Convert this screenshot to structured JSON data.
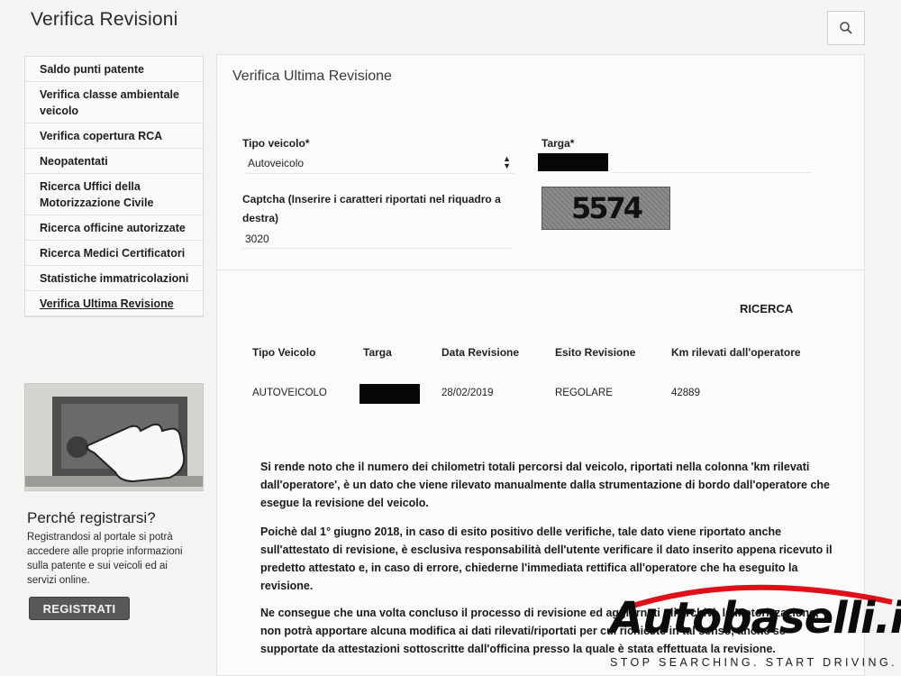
{
  "header": {
    "title": "Verifica Revisioni",
    "search_icon": "search-icon"
  },
  "sidebar": {
    "items": [
      {
        "label": "Saldo punti patente"
      },
      {
        "label": "Verifica classe ambientale veicolo"
      },
      {
        "label": "Verifica copertura RCA"
      },
      {
        "label": "Neopatentati"
      },
      {
        "label": "Ricerca Uffici della Motorizzazione Civile"
      },
      {
        "label": "Ricerca officine autorizzate"
      },
      {
        "label": "Ricerca Medici Certificatori"
      },
      {
        "label": "Statistiche immatricolazioni"
      },
      {
        "label": "Verifica Ultima Revisione",
        "active": true
      }
    ]
  },
  "promo": {
    "title": "Perché registrarsi?",
    "text": "Registrandosi al portale si potrà accedere alle proprie informazioni sulla patente e sui veicoli ed ai servizi online.",
    "button": "REGISTRATI"
  },
  "form": {
    "section_title": "Verifica Ultima Revisione",
    "tipo_veicolo_label": "Tipo veicolo*",
    "tipo_veicolo_value": "Autoveicolo",
    "targa_label": "Targa*",
    "captcha_label": "Captcha (Inserire i caratteri riportati nel riquadro a destra)",
    "captcha_value": "3020",
    "captcha_image_text": "5574"
  },
  "results": {
    "ricerca_label": "RICERCA",
    "columns": [
      "Tipo Veicolo",
      "Targa",
      "Data Revisione",
      "Esito Revisione",
      "Km rilevati dall'operatore"
    ],
    "row": {
      "tipo": "AUTOVEICOLO",
      "data": "28/02/2019",
      "esito": "REGOLARE",
      "km": "42889"
    }
  },
  "notes": [
    "Si rende noto che il numero dei chilometri totali percorsi dal veicolo, riportati nella colonna 'km rilevati dall'operatore', è un dato che viene rilevato manualmente dalla strumentazione di bordo dall'operatore che esegue la revisione del veicolo.",
    "Poichè dal 1° giugno 2018, in caso di esito positivo delle verifiche, tale dato viene riportato anche sull'attestato di revisione, è esclusiva responsabilità dell'utente verificare il dato inserito appena ricevuto il predetto attestato e, in caso di errore, chiederne l'immediata rettifica all'operatore che ha eseguito la revisione.",
    "Ne consegue che una volta concluso il processo di revisione ed aggiornati gli archivi, la Motorizzazione, non potrà apportare alcuna modifica ai dati rilevati/riportati per cui richieste in tal senso, anche se supportate da attestazioni sottoscritte dall'officina presso la quale è stata effettuata la revisione."
  ],
  "watermark": {
    "brand": "Autobaselli.it",
    "tagline": "STOP SEARCHING. START DRIVING."
  }
}
